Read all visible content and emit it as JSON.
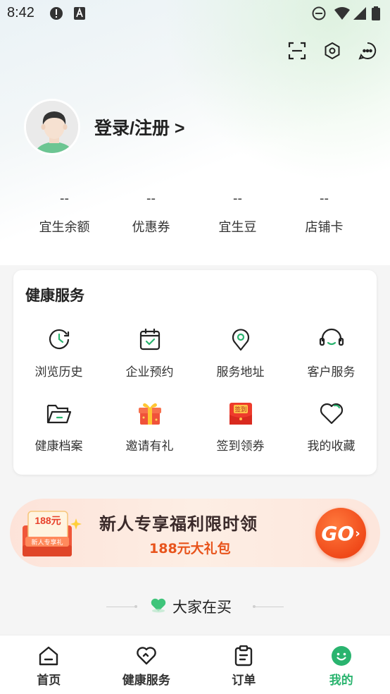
{
  "status_bar": {
    "time": "8:42"
  },
  "profile": {
    "login_label": "登录/注册 >"
  },
  "stats": [
    {
      "value": "--",
      "label": "宜生余额"
    },
    {
      "value": "--",
      "label": "优惠券"
    },
    {
      "value": "--",
      "label": "宜生豆"
    },
    {
      "value": "--",
      "label": "店铺卡"
    }
  ],
  "health_services": {
    "title": "健康服务",
    "items": [
      {
        "label": "浏览历史",
        "icon": "history-clock-icon"
      },
      {
        "label": "企业预约",
        "icon": "calendar-check-icon"
      },
      {
        "label": "服务地址",
        "icon": "location-pin-icon"
      },
      {
        "label": "客户服务",
        "icon": "headset-icon"
      },
      {
        "label": "健康档案",
        "icon": "folder-icon"
      },
      {
        "label": "邀请有礼",
        "icon": "gift-icon"
      },
      {
        "label": "签到领券",
        "icon": "checkin-envelope-icon",
        "badge": "签到"
      },
      {
        "label": "我的收藏",
        "icon": "heart-icon"
      }
    ]
  },
  "promo_banner": {
    "title": "新人专享福利限时领",
    "subtitle": "188元大礼包",
    "gift_amount": "188元",
    "gift_tag": "新人专享礼",
    "button": "GO"
  },
  "section": {
    "title": "大家在买"
  },
  "tabbar": [
    {
      "label": "首页",
      "icon": "home-icon"
    },
    {
      "label": "健康服务",
      "icon": "heart-outline-icon"
    },
    {
      "label": "订单",
      "icon": "clipboard-icon"
    },
    {
      "label": "我的",
      "icon": "smiley-icon",
      "active": true
    }
  ],
  "colors": {
    "accent": "#2ab46f",
    "promo_orange": "#e8541c"
  }
}
